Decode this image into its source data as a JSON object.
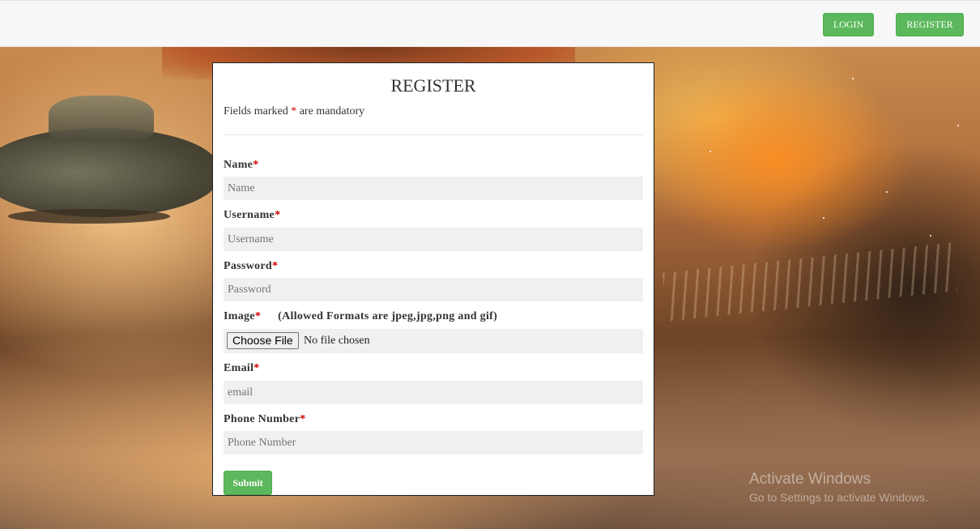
{
  "navbar": {
    "login_label": "LOGIN",
    "register_label": "REGISTER",
    "button_color": "#5cb85c"
  },
  "form": {
    "title": "REGISTER",
    "note_prefix": "Fields marked",
    "note_star": "*",
    "note_suffix": "are mandatory",
    "fields": {
      "name": {
        "label": "Name",
        "required_mark": "*",
        "placeholder": "Name"
      },
      "username": {
        "label": "Username",
        "required_mark": "*",
        "placeholder": "Username"
      },
      "password": {
        "label": "Password",
        "required_mark": "*",
        "placeholder": "Password"
      },
      "image": {
        "label": "Image",
        "required_mark": "*",
        "hint": "(Allowed Formats are jpeg,jpg,png and gif)",
        "button_label": "Choose File",
        "status": "No file chosen"
      },
      "email": {
        "label": "Email",
        "required_mark": "*",
        "placeholder": "email"
      },
      "phone": {
        "label": "Phone Number",
        "required_mark": "*",
        "placeholder": "Phone Number"
      }
    },
    "submit_label": "Submit",
    "required_color": "#cc0000"
  },
  "watermark": {
    "title": "Activate Windows",
    "subtitle": "Go to Settings to activate Windows."
  },
  "background": {
    "description_icon": "space-scene-background"
  }
}
